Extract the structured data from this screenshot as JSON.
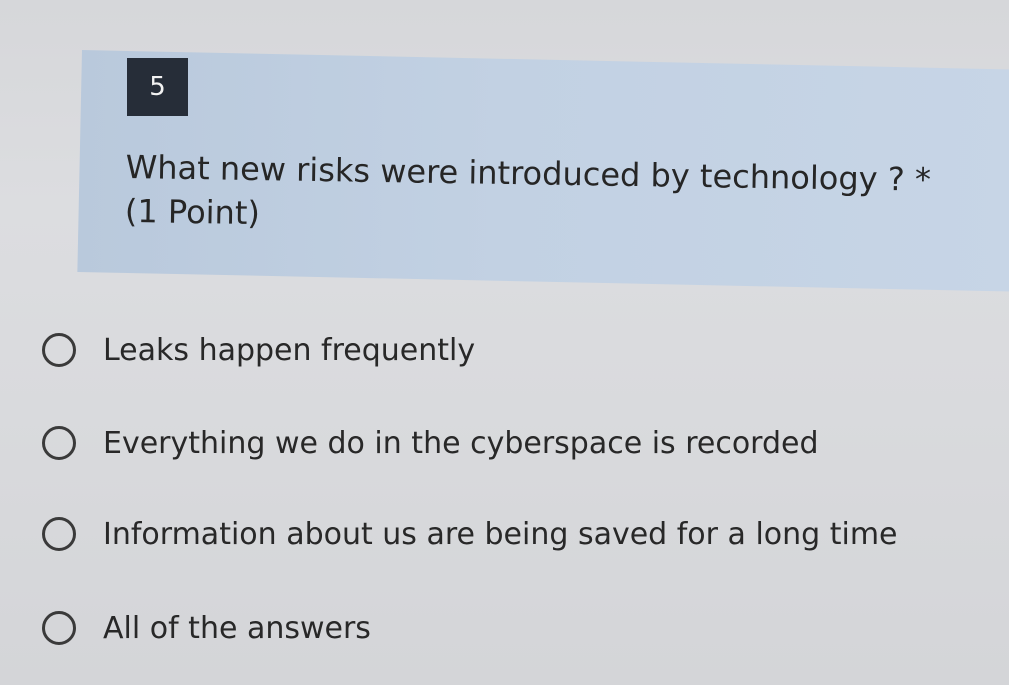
{
  "question": {
    "number": "5",
    "text": "What new risks were introduced by technology ?",
    "required_marker": "*",
    "points": "(1 Point)"
  },
  "options": [
    {
      "label": "Leaks happen frequently",
      "selected": false
    },
    {
      "label": "Everything we do in the cyberspace is recorded",
      "selected": false
    },
    {
      "label": "Information about us are being saved for a long time",
      "selected": false
    },
    {
      "label": "All of the answers",
      "selected": false
    }
  ],
  "colors": {
    "page_background": "#d9dadd",
    "question_panel": "#c2d1e3",
    "number_badge": "#262d38",
    "text": "#262626"
  }
}
